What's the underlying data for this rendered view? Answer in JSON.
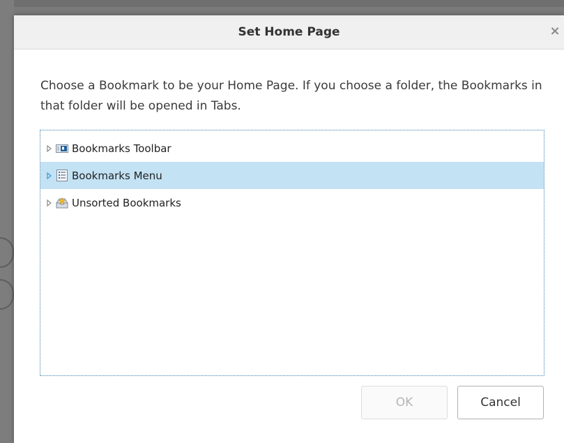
{
  "dialog": {
    "title": "Set Home Page",
    "close_glyph": "×",
    "description": "Choose a Bookmark to be your Home Page. If you choose a folder, the Bookmarks in that folder will be opened in Tabs."
  },
  "tree": {
    "items": [
      {
        "label": "Bookmarks Toolbar",
        "icon": "bookmarks-toolbar-icon",
        "selected": false
      },
      {
        "label": "Bookmarks Menu",
        "icon": "bookmarks-menu-icon",
        "selected": true
      },
      {
        "label": "Unsorted Bookmarks",
        "icon": "unsorted-bookmarks-icon",
        "selected": false
      }
    ]
  },
  "buttons": {
    "ok_label": "OK",
    "ok_enabled": false,
    "cancel_label": "Cancel"
  },
  "colors": {
    "selection": "#c3e2f4",
    "focus_border": "#3b7fb0"
  }
}
